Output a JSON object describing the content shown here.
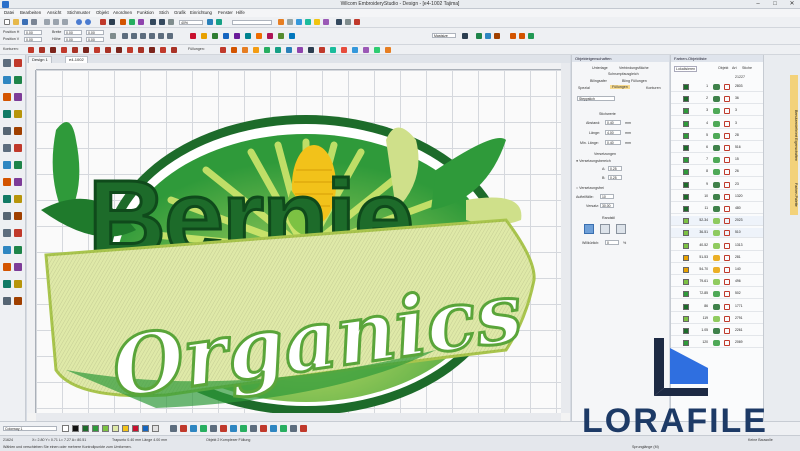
{
  "window": {
    "title": "Wilcom EmbroideryStudio - Design - [e4-1002  Tajima]"
  },
  "menu": [
    "Datei",
    "Bearbeiten",
    "Ansicht",
    "Stichmuster",
    "Objekt",
    "Anordnen",
    "Funktion",
    "Stich",
    "Grafik",
    "Einrichtung",
    "Fenster",
    "Hilfe"
  ],
  "toolbar": {
    "zoom_value": "40%",
    "position_h_label": "Position H",
    "position_v_label": "Position V",
    "breite_label": "Breite",
    "hoehe_label": "Höhe",
    "field_value": "0.00",
    "konturen_label": "Konturen:",
    "fuellungen_label": "Füllungen:",
    "machine_field": "Mastsize",
    "colors": [
      "#c8102e",
      "#e8a100",
      "#2e7d32",
      "#1565c0",
      "#6a1b9a",
      "#00838f",
      "#ef6c00",
      "#ad1457",
      "#558b2f",
      "#0277bd"
    ]
  },
  "doc_tabs": [
    "Design 1",
    "e4-1002"
  ],
  "canvas": {
    "words": [
      "Bernie",
      "Organics"
    ],
    "colors": {
      "dark_green": "#1d6b2a",
      "mid_green": "#2f9a3a",
      "light_green": "#7cc243",
      "cream": "#dfe9a8",
      "corn": "#f2c21a"
    }
  },
  "obj_props": {
    "title": "Objekteigenschaften",
    "tabs": [
      "Unterlage",
      "Verbindungsfläche",
      "Schrumpfausgleich",
      "Bilingsafer",
      "Bling Füllungen",
      "Spezial",
      "Füllungen",
      "Konturen"
    ],
    "fill_type": "Steppstich",
    "section_stitch": "Stichwerte",
    "abstand_label": "Abstand:",
    "abstand_value": "0.40",
    "unit": "mm",
    "laenge_label": "Länge:",
    "laenge_value": "4.00",
    "min_laenge_label": "Min. Länge:",
    "min_laenge_value": "0.40",
    "versetzungen_label": "Versetzungen",
    "radio1": "Versetzungsbereich",
    "a_label": "A:",
    "a_value": "0.25",
    "b_label": "B:",
    "b_value": "0.25",
    "radio2": "Versetzungsfrei",
    "aufteilfaelle_label": "Aufteilfälle:",
    "aufteilfaelle_value": "10",
    "versatz_label": "Versatz:",
    "versatz_value": "30.00",
    "section_rand": "Randstil",
    "winkel_label": "Willkürlich:",
    "winkel_value": "0",
    "pct": "%"
  },
  "obj_list": {
    "title": "Farben-Objektliste",
    "tabs": [
      "Lokalisieren",
      "Objekt",
      "Art",
      "Stiche"
    ],
    "total": "21227",
    "rows": [
      {
        "n": "1",
        "v": "2803",
        "c": "#1d6b2a"
      },
      {
        "n": "2",
        "v": "36",
        "c": "#1d6b2a"
      },
      {
        "n": "3",
        "v": "3",
        "c": "#2f9a3a"
      },
      {
        "n": "4",
        "v": "3",
        "c": "#2f9a3a"
      },
      {
        "n": "5",
        "v": "28",
        "c": "#2f9a3a"
      },
      {
        "n": "6",
        "v": "516",
        "c": "#1d6b2a"
      },
      {
        "n": "7",
        "v": "15",
        "c": "#2f9a3a"
      },
      {
        "n": "8",
        "v": "26",
        "c": "#2f9a3a"
      },
      {
        "n": "9",
        "v": "23",
        "c": "#1d6b2a"
      },
      {
        "n": "10",
        "v": "1320",
        "c": "#1d6b2a"
      },
      {
        "n": "11",
        "v": "480",
        "c": "#1d6b2a"
      },
      {
        "n": "52-34",
        "v": "2023",
        "c": "#7cc243"
      },
      {
        "n": "36-51",
        "v": "510",
        "c": "#7cc243"
      },
      {
        "n": "40-52",
        "v": "1313",
        "c": "#7cc243"
      },
      {
        "n": "51-53",
        "v": "281",
        "c": "#e8a100"
      },
      {
        "n": "54-70",
        "v": "140",
        "c": "#e8a100"
      },
      {
        "n": "79-61",
        "v": "496",
        "c": "#7cc243"
      },
      {
        "n": "72-85",
        "v": "502",
        "c": "#2f9a3a"
      },
      {
        "n": "86",
        "v": "1771",
        "c": "#1d6b2a"
      },
      {
        "n": "119",
        "v": "2791",
        "c": "#7cc243"
      },
      {
        "n": "1.05",
        "v": "2261",
        "c": "#1d6b2a"
      },
      {
        "n": "120",
        "v": "2069",
        "c": "#2f9a3a"
      }
    ]
  },
  "side_tabs": [
    "Benutzerdefiniert Eigenschaften",
    "Farben-Palette"
  ],
  "bottom": {
    "colorway": "Colorway 1",
    "palette": [
      "#ffffff",
      "#111111",
      "#1d6b2a",
      "#2f9a3a",
      "#7cc243",
      "#dfe9a8",
      "#f2c21a",
      "#c8102e",
      "#1565c0",
      "#e0e0e0"
    ]
  },
  "status": {
    "stitches": "21624",
    "coords": "X= 2.80 Y= 0.71 L= 7.27 A= 80.51",
    "trapunto": "Trapunto 0.40 mm Länge 4.00 mm",
    "objekt": "Objekt 2 Komplexer Füllung",
    "hint": "Wählen und verschieben Sie einen oder mehrere Kontrollpunkte zum Umformen.",
    "sprung": "Sprunglänge (M)",
    "reines": "Keine Bauwolle"
  },
  "watermark": "LORAFILE"
}
